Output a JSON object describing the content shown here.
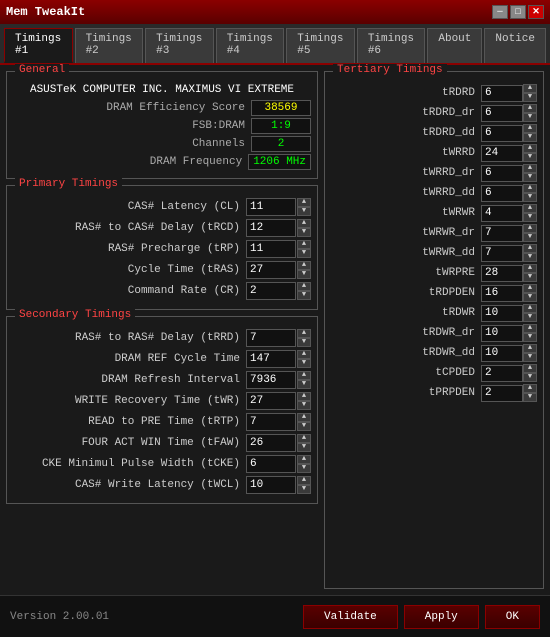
{
  "titleBar": {
    "title": "Mem TweakIt",
    "minimizeBtn": "─",
    "maximizeBtn": "□",
    "closeBtn": "✕"
  },
  "tabs": [
    {
      "label": "Timings #1",
      "active": true
    },
    {
      "label": "Timings #2",
      "active": false
    },
    {
      "label": "Timings #3",
      "active": false
    },
    {
      "label": "Timings #4",
      "active": false
    },
    {
      "label": "Timings #5",
      "active": false
    },
    {
      "label": "Timings #6",
      "active": false
    },
    {
      "label": "About",
      "active": false
    },
    {
      "label": "Notice",
      "active": false
    }
  ],
  "general": {
    "label": "General",
    "motherboard": "ASUSTeK COMPUTER INC. MAXIMUS VI EXTREME",
    "dramEfficiency": {
      "label": "DRAM Efficiency Score",
      "value": "38569"
    },
    "fsbDram": {
      "label": "FSB:DRAM",
      "value": "1:9"
    },
    "channels": {
      "label": "Channels",
      "value": "2"
    },
    "dramFreq": {
      "label": "DRAM Frequency",
      "value": "1206 MHz"
    }
  },
  "primaryTimings": {
    "label": "Primary Timings",
    "rows": [
      {
        "label": "CAS# Latency (CL)",
        "value": "11"
      },
      {
        "label": "RAS# to CAS# Delay (tRCD)",
        "value": "12"
      },
      {
        "label": "RAS# Precharge (tRP)",
        "value": "11"
      },
      {
        "label": "Cycle Time (tRAS)",
        "value": "27"
      },
      {
        "label": "Command Rate (CR)",
        "value": "2"
      }
    ]
  },
  "secondaryTimings": {
    "label": "Secondary Timings",
    "rows": [
      {
        "label": "RAS# to RAS# Delay (tRRD)",
        "value": "7"
      },
      {
        "label": "DRAM REF Cycle Time",
        "value": "147"
      },
      {
        "label": "DRAM Refresh Interval",
        "value": "7936"
      },
      {
        "label": "WRITE Recovery Time (tWR)",
        "value": "27"
      },
      {
        "label": "READ to PRE Time (tRTP)",
        "value": "7"
      },
      {
        "label": "FOUR ACT WIN Time (tFAW)",
        "value": "26"
      },
      {
        "label": "CKE Minimul Pulse Width (tCKE)",
        "value": "6"
      },
      {
        "label": "CAS# Write Latency (tWCL)",
        "value": "10"
      }
    ]
  },
  "tertiaryTimings": {
    "label": "Tertiary Timings",
    "rows": [
      {
        "label": "tRDRD",
        "value": "6"
      },
      {
        "label": "tRDRD_dr",
        "value": "6"
      },
      {
        "label": "tRDRD_dd",
        "value": "6"
      },
      {
        "label": "tWRRD",
        "value": "24"
      },
      {
        "label": "tWRRD_dr",
        "value": "6"
      },
      {
        "label": "tWRRD_dd",
        "value": "6"
      },
      {
        "label": "tWRWR",
        "value": "4"
      },
      {
        "label": "tWRWR_dr",
        "value": "7"
      },
      {
        "label": "tWRWR_dd",
        "value": "7"
      },
      {
        "label": "tWRPRE",
        "value": "28"
      },
      {
        "label": "tRDPDEN",
        "value": "16"
      },
      {
        "label": "tRDWR",
        "value": "10"
      },
      {
        "label": "tRDWR_dr",
        "value": "10"
      },
      {
        "label": "tRDWR_dd",
        "value": "10"
      },
      {
        "label": "tCPDED",
        "value": "2"
      },
      {
        "label": "tPRPDEN",
        "value": "2"
      }
    ]
  },
  "bottomBar": {
    "version": "Version 2.00.01",
    "validateBtn": "Validate",
    "applyBtn": "Apply",
    "okBtn": "OK"
  }
}
